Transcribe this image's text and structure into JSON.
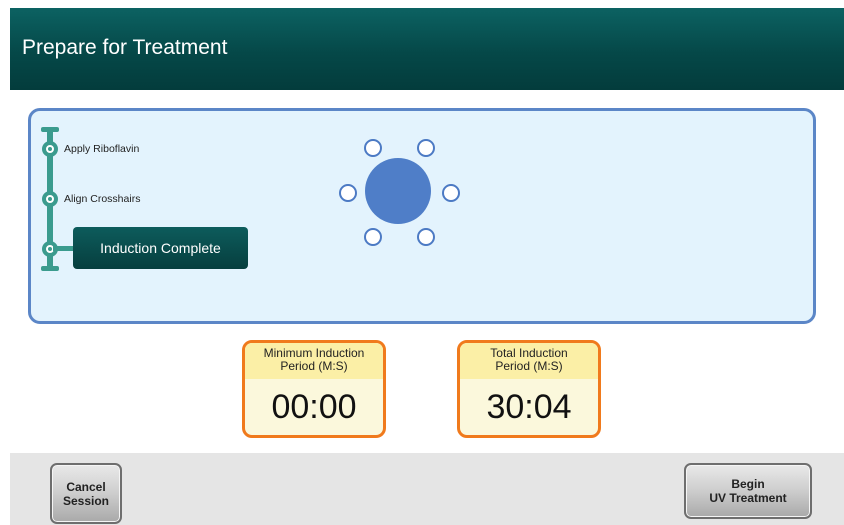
{
  "header": {
    "title": "Prepare for Treatment"
  },
  "steps": [
    {
      "label": "Apply Riboflavin"
    },
    {
      "label": "Align Crosshairs"
    },
    {
      "label": "Induction Complete",
      "active": true
    }
  ],
  "timers": {
    "minimum": {
      "label_line1": "Minimum Induction",
      "label_line2": "Period (M:S)",
      "value": "00:00"
    },
    "total": {
      "label_line1": "Total Induction",
      "label_line2": "Period (M:S)",
      "value": "30:04"
    }
  },
  "footer": {
    "cancel": {
      "line1": "Cancel",
      "line2": "Session"
    },
    "begin": {
      "line1": "Begin",
      "line2": "UV Treatment"
    }
  },
  "colors": {
    "header": "#054848",
    "panel_border": "#5b86c7",
    "panel_bg": "#e3f3fd",
    "step_rail": "#3a9b8e",
    "timer_border": "#f07a1c",
    "eye": "#4f7ec8"
  }
}
